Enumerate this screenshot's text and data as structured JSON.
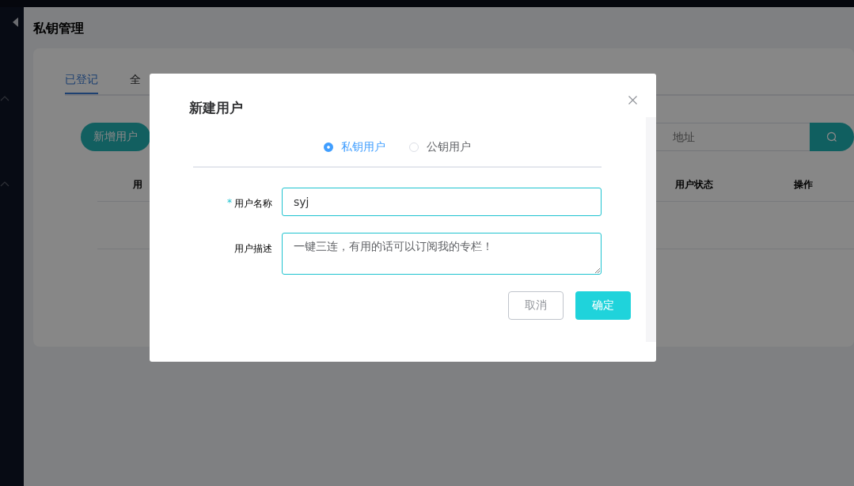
{
  "page": {
    "title": "私钥管理"
  },
  "tabs": [
    {
      "label": "已登记",
      "selected": true
    },
    {
      "label": "全",
      "selected": false
    }
  ],
  "add_button": "新增用户",
  "search": {
    "placeholder": "地址"
  },
  "table": {
    "columns": [
      "用",
      "用户状态",
      "操作"
    ]
  },
  "dialog": {
    "title": "新建用户",
    "required_mark": "*",
    "user_types": [
      {
        "label": "私钥用户",
        "selected": true
      },
      {
        "label": "公钥用户",
        "selected": false
      }
    ],
    "fields": [
      {
        "kind": "input",
        "label": "用户名称",
        "required": true,
        "value": "syj"
      },
      {
        "kind": "textarea",
        "label": "用户描述",
        "required": false,
        "value": "一键三连，有用的话可以订阅我的专栏！"
      }
    ],
    "buttons": [
      {
        "kind": "secondary",
        "label": "取消"
      },
      {
        "kind": "primary",
        "label": "确定"
      }
    ]
  }
}
